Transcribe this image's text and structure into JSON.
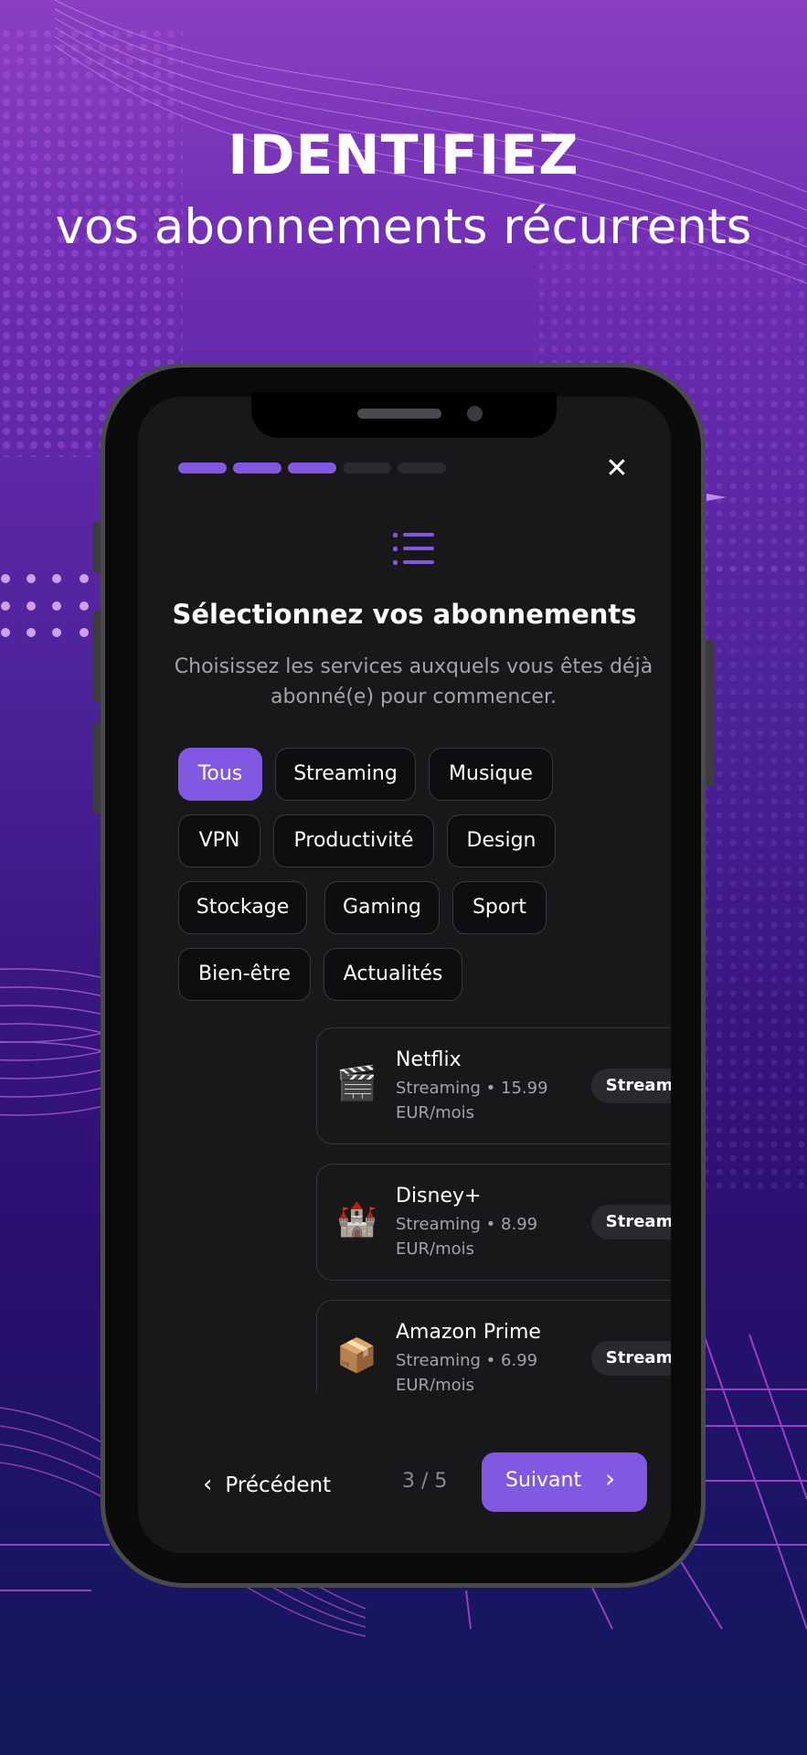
{
  "headline": {
    "line1": "IDENTIFIEZ",
    "line2": "vos abonnements récurrents"
  },
  "progress": {
    "current_step": 3,
    "total_steps": 5,
    "active_color": "#8058e2",
    "inactive_color": "#2a2a2e"
  },
  "header": {
    "close_icon": "close-icon",
    "list_icon": "list-icon"
  },
  "title": "Sélectionnez vos abonnements",
  "subtitle": "Choisissez les services auxquels vous êtes déjà abonné(e) pour commencer.",
  "filters": [
    "Tous",
    "Streaming",
    "Musique",
    "VPN",
    "Productivité",
    "Design",
    "Stockage",
    "Gaming",
    "Sport",
    "Bien-être",
    "Actualités"
  ],
  "selected_filter": "Tous",
  "services": [
    {
      "emoji": "🎬",
      "name": "Netflix",
      "meta": "Streaming • 15.99 EUR/mois",
      "badge": "Streaming",
      "add_icon": "plus-icon"
    },
    {
      "emoji": "🏰",
      "name": "Disney+",
      "meta": "Streaming • 8.99 EUR/mois",
      "badge": "Streaming",
      "add_icon": "plus-icon"
    },
    {
      "emoji": "📦",
      "name": "Amazon Prime",
      "meta": "Streaming • 6.99 EUR/mois",
      "badge": "Streaming",
      "add_icon": "plus-icon"
    }
  ],
  "footer": {
    "prev_label": "Précédent",
    "page_indicator": "3 / 5",
    "next_label": "Suivant"
  },
  "colors": {
    "accent": "#8058e2",
    "background_top": "#8a3fc2",
    "background_bottom": "#121a5a",
    "screen": "#18181a"
  }
}
